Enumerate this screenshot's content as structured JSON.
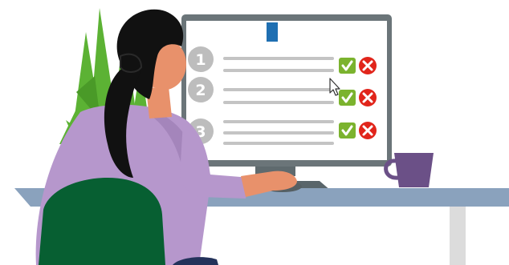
{
  "survey": {
    "questions": [
      {
        "number": "1",
        "answer_yes": "check-icon",
        "answer_no": "x-icon"
      },
      {
        "number": "2",
        "answer_yes": "check-icon",
        "answer_no": "x-icon"
      },
      {
        "number": "3",
        "answer_yes": "check-icon",
        "answer_no": "x-icon"
      }
    ]
  },
  "colors": {
    "monitor_frame": "#6b7579",
    "screen": "#ffffff",
    "accent_tab": "#1f6fb2",
    "question_number_circle": "#bdbdbd",
    "answer_line": "#c4c4c4",
    "check_green": "#7bb32e",
    "cross_red": "#e1251b",
    "desk_top": "#8aa2bd",
    "desk_leg": "#dcdcdc",
    "mug": "#6b5087",
    "plant_green": "#5cb234",
    "hair": "#111111",
    "skin": "#e8916b",
    "shirt": "#b697cc",
    "chair": "#075f32"
  }
}
